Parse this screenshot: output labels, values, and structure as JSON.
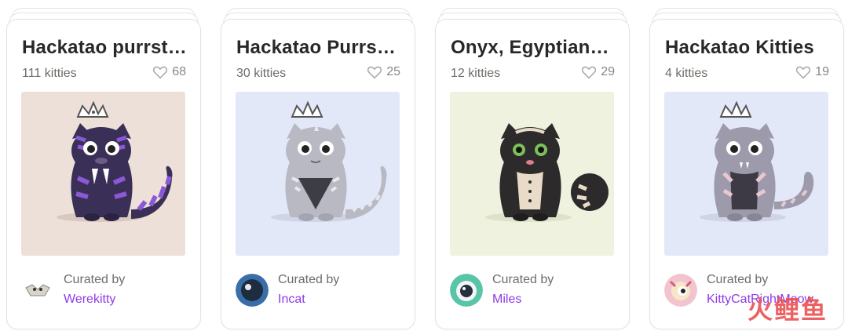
{
  "cards": [
    {
      "title": "Hackatao purrst…",
      "count": "111 kitties",
      "likes": "68",
      "bg": "#ede0d9",
      "fur": "#3a2f57",
      "pattern": "#8a59d6",
      "curated_label": "Curated by",
      "curator": "Werekitty"
    },
    {
      "title": "Hackatao Purrst…",
      "count": "30 kitties",
      "likes": "25",
      "bg": "#e3e8f8",
      "fur": "#b9b9c4",
      "pattern": "#dcdce4",
      "curated_label": "Curated by",
      "curator": "Incat"
    },
    {
      "title": "Onyx, Egyptiank…",
      "count": "12 kitties",
      "likes": "29",
      "bg": "#eef2df",
      "fur": "#2d2a2b",
      "pattern": "#e8dcc8",
      "curated_label": "Curated by",
      "curator": "Miles"
    },
    {
      "title": "Hackatao Kitties",
      "count": "4 kitties",
      "likes": "19",
      "bg": "#e3e8f8",
      "fur": "#9d9aab",
      "pattern": "#e8c8d0",
      "curated_label": "Curated by",
      "curator": "KittyCatRightMeow"
    }
  ],
  "watermark": "火鲤鱼",
  "colors": {
    "accent": "#8e3ae6",
    "text": "#2a2825",
    "muted": "#6f6c68"
  }
}
